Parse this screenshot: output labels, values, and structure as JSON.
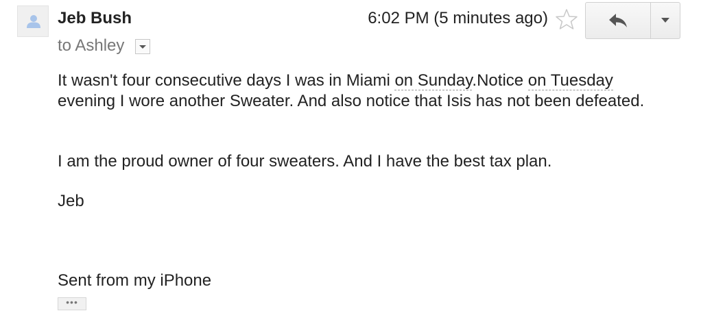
{
  "email": {
    "sender_name": "Jeb Bush",
    "timestamp": "6:02 PM (5 minutes ago)",
    "recipients": "to Ashley",
    "body": {
      "p1_pre": "It wasn't four consecutive days I was in Miami ",
      "p1_link1": "on Sunday",
      "p1_mid": ".Notice ",
      "p1_link2": "on Tuesday",
      "p1_post": " evening I wore another Sweater. And also notice that Isis has not been defeated.",
      "p2": "I am the proud owner of four sweaters. And I have the best tax plan.",
      "p3": "Jeb",
      "p4": "Sent from my iPhone"
    },
    "trimmed_content_label": "•••"
  },
  "icons": {
    "avatar": "person-icon",
    "star": "star-icon",
    "reply": "reply-icon",
    "more": "chevron-down-icon",
    "recipients_dropdown": "chevron-down-icon"
  },
  "colors": {
    "avatar_figure": "#a8c4ea",
    "secondary_text": "#777777",
    "primary_text": "#222222"
  }
}
